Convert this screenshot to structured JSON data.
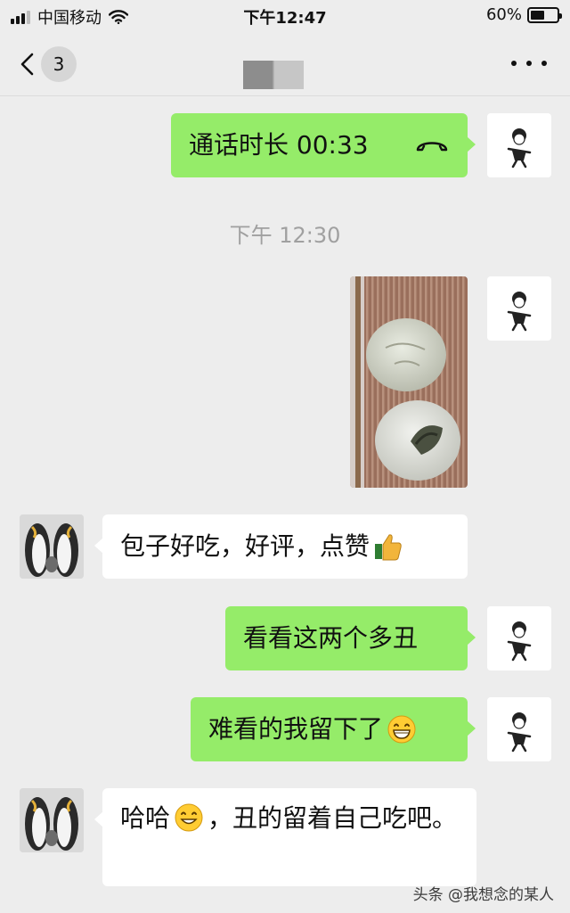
{
  "status_bar": {
    "carrier": "中国移动",
    "time": "下午12:47",
    "battery_percent_text": "60%",
    "battery_level": 0.6,
    "signal_bars": 4,
    "signal_bars_active": 3
  },
  "nav": {
    "unread_count": "3"
  },
  "messages": {
    "call": {
      "text": "通话时长 00:33"
    },
    "timestamp": "下午 12:30",
    "msg_baozi": {
      "text": "包子好吃，好评，点赞",
      "emoji": "thumbs-up"
    },
    "msg_look": {
      "text": "看看这两个多丑"
    },
    "msg_ugly": {
      "text": "难看的我留下了",
      "emoji": "grinning-face"
    },
    "msg_haha": {
      "text_before": "哈哈",
      "emoji": "smiling-face",
      "text_after": "，丑的留着自己吃吧。"
    }
  },
  "watermark": "头条 @我想念的某人",
  "colors": {
    "background": "#ededed",
    "outgoing_bubble": "#95ec69",
    "incoming_bubble": "#ffffff"
  }
}
